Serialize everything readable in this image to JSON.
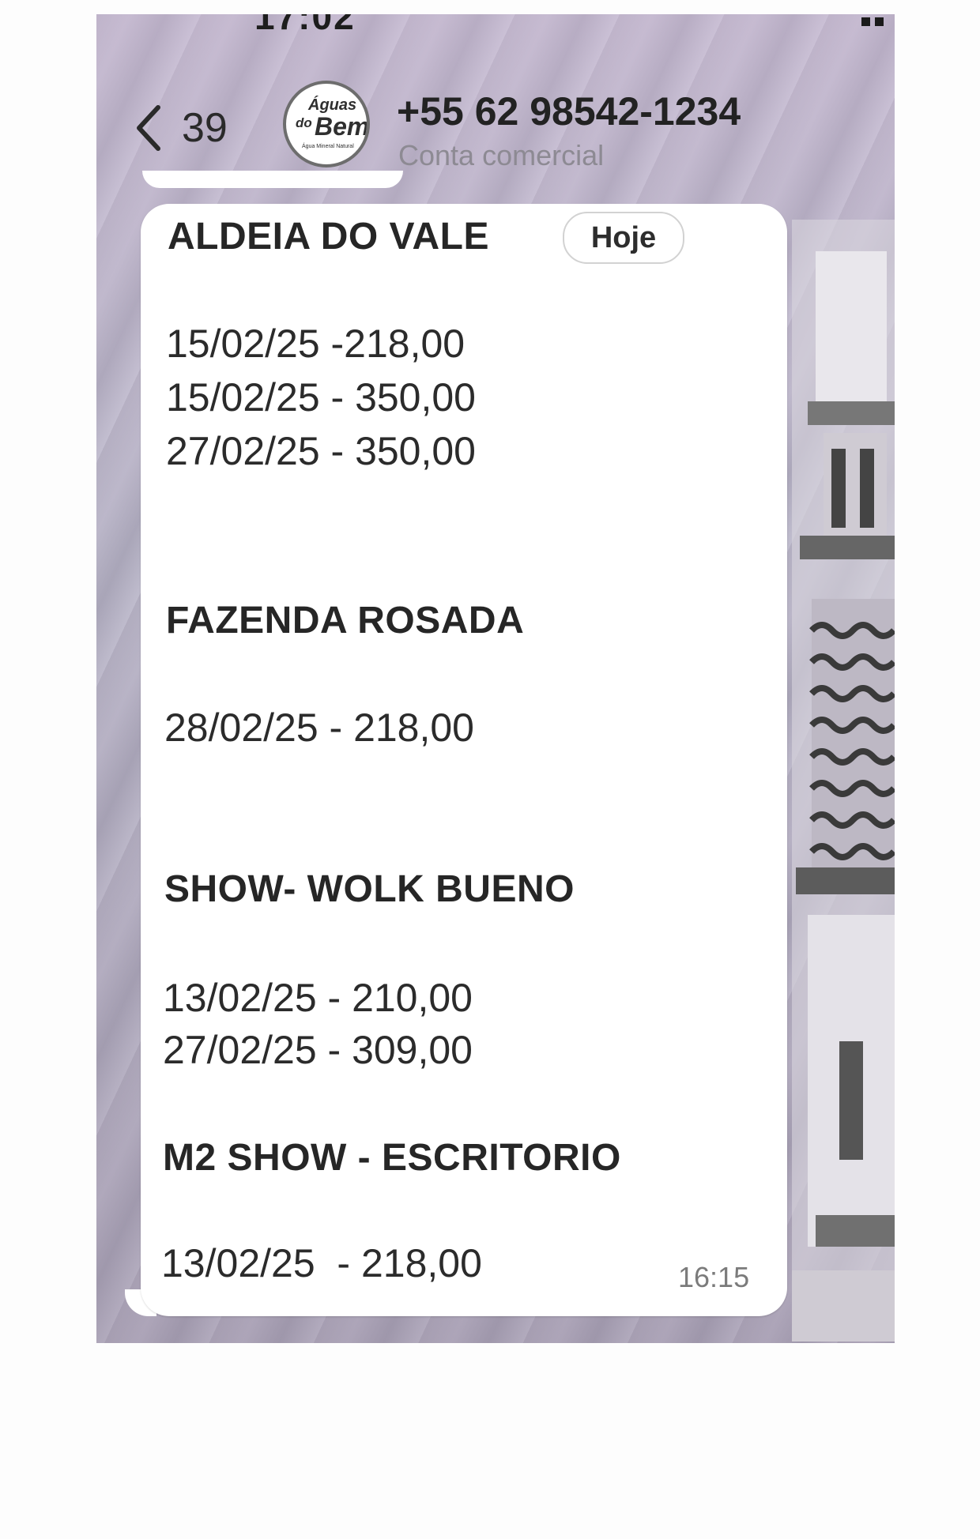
{
  "header": {
    "back_count": "39",
    "contact_phone": "+55 62 98542-1234",
    "contact_subtitle": "Conta comercial",
    "avatar_logo": {
      "line1": "Águas",
      "line2": "do",
      "line3": "Bem",
      "tagline": "Água Mineral Natural"
    }
  },
  "message": {
    "date_chip": "Hoje",
    "groups": [
      {
        "title": "ALDEIA DO VALE",
        "entries": [
          "15/02/25 -218,00",
          "15/02/25 - 350,00",
          "27/02/25 - 350,00"
        ]
      },
      {
        "title": "FAZENDA ROSADA",
        "entries": [
          "28/02/25 - 218,00"
        ]
      },
      {
        "title": "SHOW- WOLK BUENO",
        "entries": [
          "13/02/25 - 210,00",
          "27/02/25 - 309,00"
        ]
      },
      {
        "title": "M2 SHOW - ESCRITORIO",
        "entries": [
          "13/02/25  - 218,00"
        ]
      }
    ],
    "time": "16:15"
  },
  "colors": {
    "bubble": "#ffffff",
    "wallpaper": "#b9b3c6",
    "text": "#262626",
    "subtitle": "#8d8a93"
  },
  "icons": [
    "chevron-left-icon"
  ]
}
